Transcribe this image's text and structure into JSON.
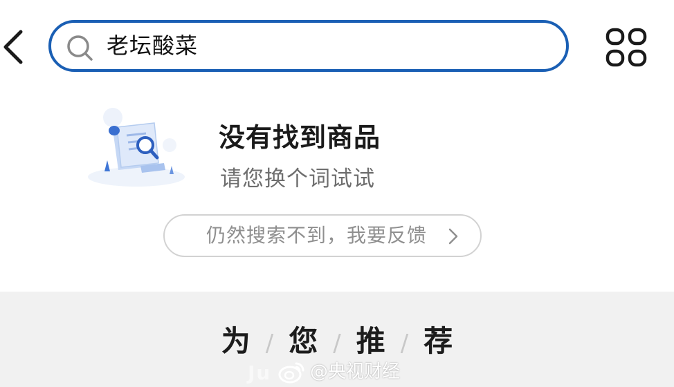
{
  "header": {
    "back_icon": "chevron-left-icon",
    "search": {
      "icon": "search-icon",
      "query": "老坛酸菜"
    },
    "menu_icon": "grid-icon"
  },
  "empty_state": {
    "illustration": "document-search-illustration",
    "title": "没有找到商品",
    "subtitle": "请您换个词试试",
    "feedback_button": {
      "label": "仍然搜索不到，我要反馈",
      "icon": "chevron-right-icon"
    }
  },
  "recommend": {
    "chars": [
      "为",
      "您",
      "推",
      "荐"
    ],
    "separator": "/"
  },
  "watermark": {
    "ghost_text": "Ju",
    "text": "@央视财经",
    "icon": "weibo-logo-icon"
  },
  "colors": {
    "accent": "#1a5fb4",
    "section_bg": "#f1f1f1",
    "subtitle": "#6e6e6e",
    "feedback_text": "#8f8f8f"
  }
}
